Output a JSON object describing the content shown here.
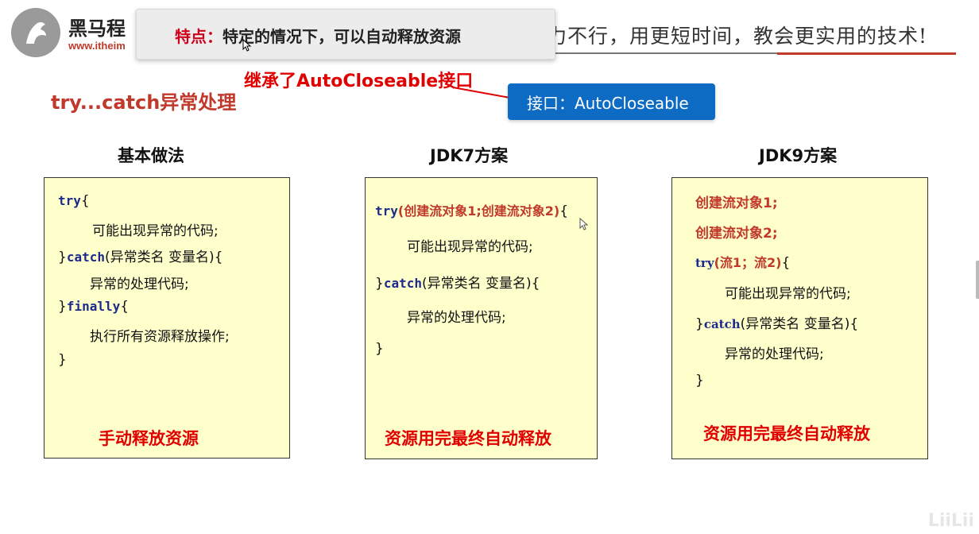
{
  "header": {
    "logo_title": "黑马程",
    "logo_url": "www.itheim",
    "slogan": "力不行，用更短时间，教会更实用的技术!"
  },
  "popup": {
    "label": "特点：",
    "text": "特定的情况下，可以自动释放资源"
  },
  "annotation": {
    "inherit_note": "继承了AutoCloseable接口",
    "interface_box": "接口：AutoCloseable"
  },
  "section_title": "try...catch异常处理",
  "columns": [
    {
      "heading": "基本做法",
      "code": {
        "try_kw": "try",
        "try_open": "{",
        "line1": "可能出现异常的代码;",
        "close1": "}",
        "catch_kw": "catch",
        "catch_rest": "(异常类名 变量名){",
        "line2": "异常的处理代码;",
        "close2": "}",
        "finally_kw": "finally",
        "finally_open": "{",
        "line3": "执行所有资源释放操作;",
        "close3": "}"
      },
      "footer": "手动释放资源"
    },
    {
      "heading": "JDK7方案",
      "code": {
        "try_kw": "try",
        "try_args": "(创建流对象1;创建流对象2)",
        "try_open": "{",
        "line1": "可能出现异常的代码;",
        "close1": "}",
        "catch_kw": "catch",
        "catch_rest": "(异常类名 变量名){",
        "line2": "异常的处理代码;",
        "close2": "}"
      },
      "footer": "资源用完最终自动释放"
    },
    {
      "heading": "JDK9方案",
      "code": {
        "create1": "创建流对象1;",
        "create2": "创建流对象2;",
        "try_kw": "try",
        "try_args": "(流1；流2)",
        "try_open": "{",
        "line1": "可能出现异常的代码;",
        "close1": "}",
        "catch_kw": "catch",
        "catch_rest": "(异常类名 变量名){",
        "line2": "异常的处理代码;",
        "close2": "}"
      },
      "footer": "资源用完最终自动释放"
    }
  ],
  "watermark": "LiiLii",
  "colors": {
    "accent_red": "#e00000",
    "interface_blue": "#0d6bc4",
    "panel_bg": "#ffffcc",
    "keyword_blue": "#1c2a8c"
  }
}
